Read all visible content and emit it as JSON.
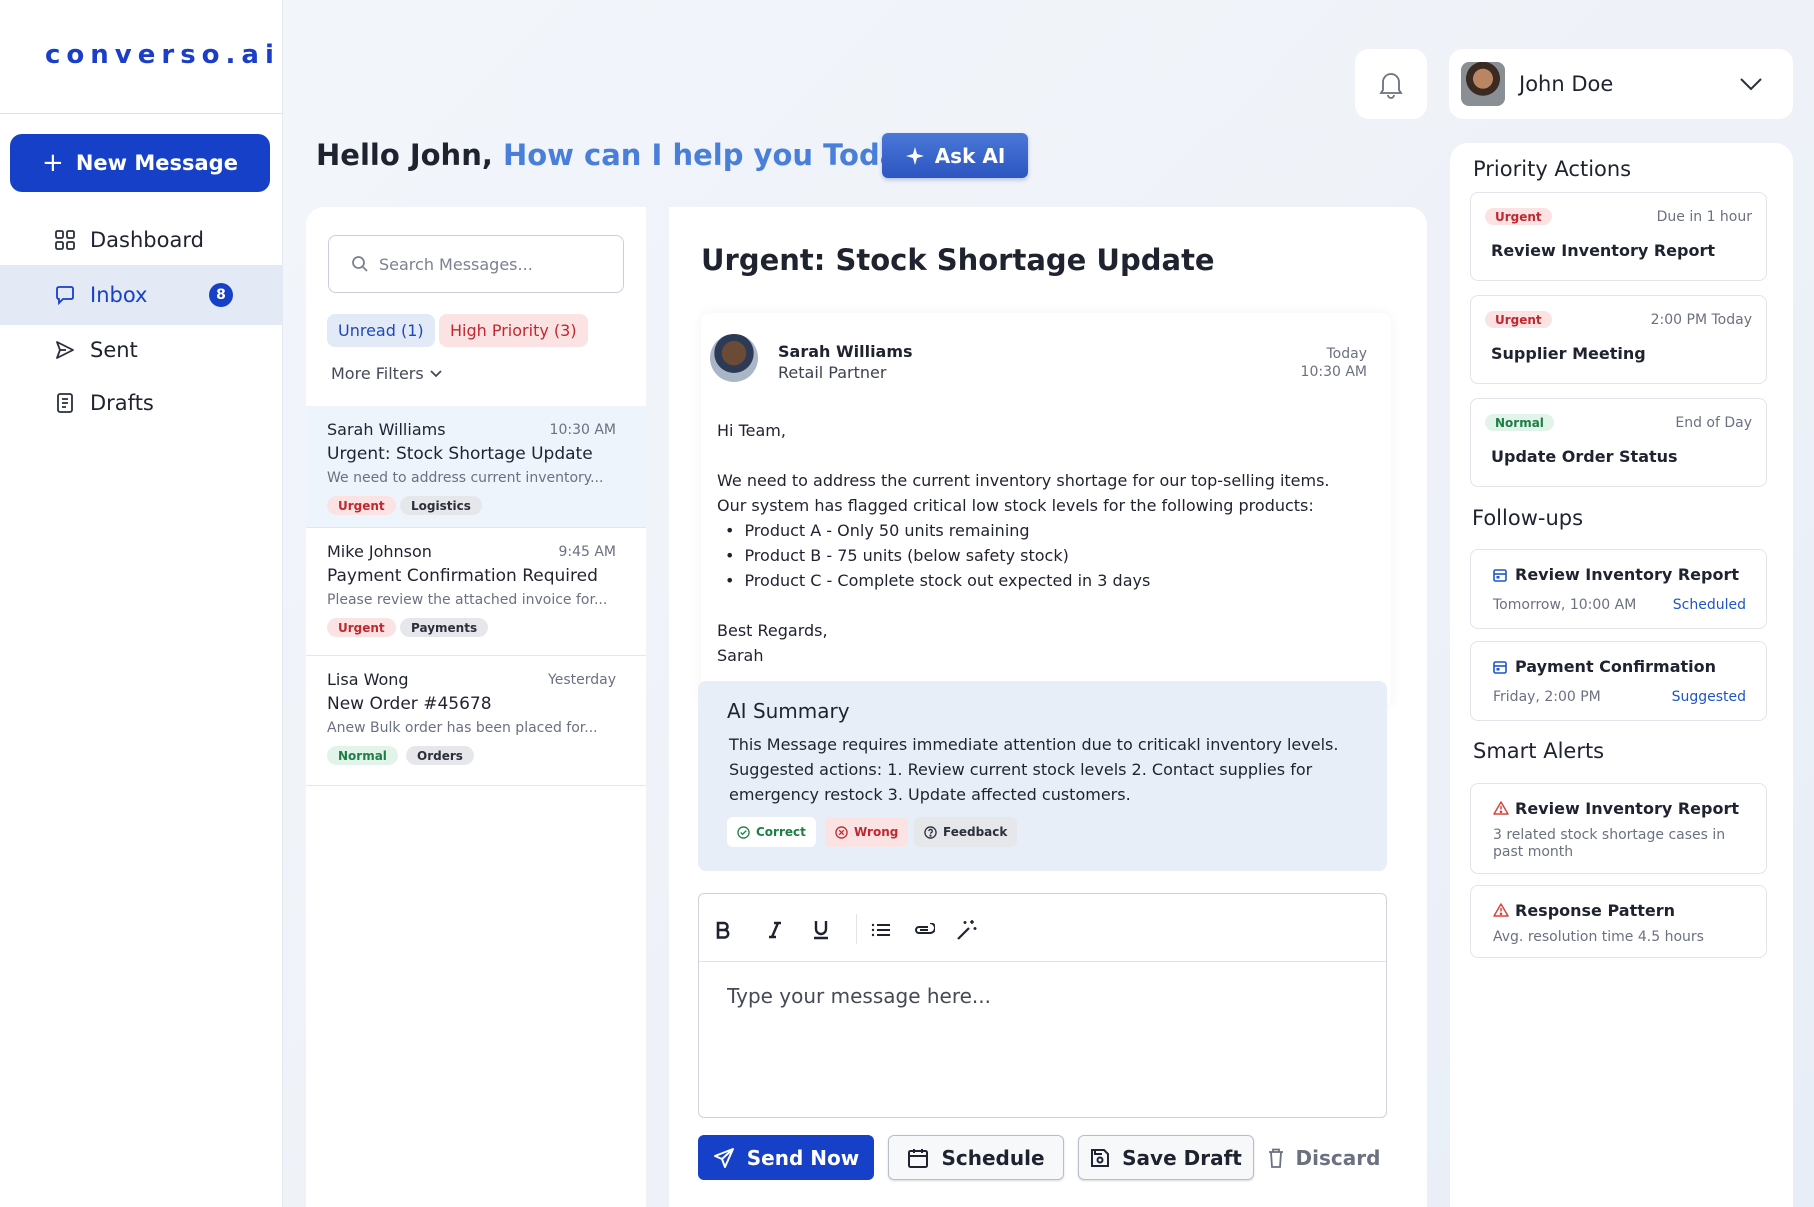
{
  "app": {
    "logo": "converso.ai",
    "new_message_label": "New Message"
  },
  "sidebar": {
    "items": [
      {
        "label": "Dashboard",
        "icon": "grid-icon"
      },
      {
        "label": "Inbox",
        "icon": "chat-icon",
        "badge": "8",
        "active": true
      },
      {
        "label": "Sent",
        "icon": "send-icon"
      },
      {
        "label": "Drafts",
        "icon": "document-icon"
      }
    ]
  },
  "header": {
    "greeting_name": "Hello John, ",
    "greeting_question": "How can I help you Today?",
    "ask_ai_label": "Ask AI",
    "user_name": "John Doe"
  },
  "list": {
    "search_placeholder": "Search Messages...",
    "chip_unread": "Unread (1)",
    "chip_priority": "High Priority (3)",
    "more_filters": "More Filters",
    "messages": [
      {
        "sender": "Sarah Williams",
        "time": "10:30 AM",
        "subject": "Urgent: Stock Shortage Update",
        "preview": "We need to address current inventory...",
        "tags": [
          "Urgent",
          "Logistics"
        ]
      },
      {
        "sender": "Mike Johnson",
        "time": "9:45 AM",
        "subject": "Payment Confirmation Required",
        "preview": "Please review the attached invoice for...",
        "tags": [
          "Urgent",
          "Payments"
        ]
      },
      {
        "sender": "Lisa Wong",
        "time": "Yesterday",
        "subject": "New Order #45678",
        "preview": "Anew Bulk order has been placed for...",
        "tags": [
          "Normal",
          "Orders"
        ]
      }
    ]
  },
  "detail": {
    "title": "Urgent: Stock Shortage Update",
    "sender_name": "Sarah Williams",
    "sender_role": "Retail Partner",
    "date_day": "Today",
    "date_time": "10:30 AM",
    "greeting": "Hi Team,",
    "line1": "We need to address the current inventory shortage for our top-selling items.",
    "line2": "Our system has flagged critical low stock levels for the following products:",
    "bullets": [
      "Product A - Only 50 units remaining",
      "Product B - 75 units (below safety stock)",
      "Product C - Complete stock out expected in 3 days"
    ],
    "signoff": "Best Regards,",
    "signature": "Sarah",
    "ai_title": "AI Summary",
    "ai_text": "This Message requires immediate attention due to criticakl inventory levels. Suggested actions: 1. Review current stock levels 2. Contact supplies for emergency restock 3. Update affected customers.",
    "fb_correct": "Correct",
    "fb_wrong": "Wrong",
    "fb_feedback": "Feedback",
    "editor_placeholder": "Type your message here...",
    "send_label": "Send Now",
    "schedule_label": "Schedule",
    "save_label": "Save Draft",
    "discard_label": "Discard"
  },
  "right": {
    "priority_heading": "Priority Actions",
    "priority": [
      {
        "tag": "Urgent",
        "due": "Due in 1 hour",
        "title": "Review Inventory Report"
      },
      {
        "tag": "Urgent",
        "due": "2:00 PM Today",
        "title": "Supplier Meeting"
      },
      {
        "tag": "Normal",
        "due": "End of Day",
        "title": "Update Order Status"
      }
    ],
    "followups_heading": "Follow-ups",
    "followups": [
      {
        "title": "Review Inventory Report",
        "time": "Tomorrow, 10:00 AM",
        "status": "Scheduled"
      },
      {
        "title": "Payment Confirmation",
        "time": "Friday, 2:00 PM",
        "status": "Suggested"
      }
    ],
    "alerts_heading": "Smart Alerts",
    "alerts": [
      {
        "title": "Review Inventory Report",
        "desc": "3 related stock shortage cases in past month"
      },
      {
        "title": "Response Pattern",
        "desc": "Avg. resolution time 4.5 hours"
      }
    ]
  },
  "colors": {
    "brand": "#1640c8",
    "accent_text": "#4a7fd9",
    "urgent": "#c0282f",
    "normal": "#1d7f46"
  }
}
